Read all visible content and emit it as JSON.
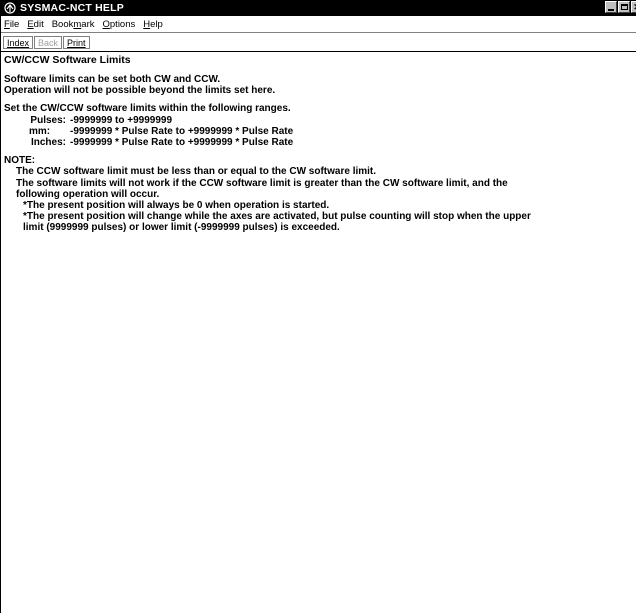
{
  "window": {
    "title": "SYSMAC-NCT HELP"
  },
  "menu": [
    {
      "pre": "",
      "u": "F",
      "post": "ile"
    },
    {
      "pre": "",
      "u": "E",
      "post": "dit"
    },
    {
      "pre": "Book",
      "u": "m",
      "post": "ark"
    },
    {
      "pre": "",
      "u": "O",
      "post": "ptions"
    },
    {
      "pre": "",
      "u": "H",
      "post": "elp"
    }
  ],
  "toolbar": {
    "index_label": "Index",
    "back_label": "Back",
    "print_label": "Print"
  },
  "topic": {
    "title": "CW/CCW Software Limits",
    "intro": [
      "Software limits can be set both CW and CCW.",
      "Operation will not be possible beyond the limits set here."
    ],
    "range_intro": "Set the CW/CCW software limits within the following ranges.",
    "ranges": [
      {
        "label": "Pulses:",
        "value": "-9999999 to +9999999"
      },
      {
        "label": "mm:",
        "value": "-9999999 * Pulse Rate to +9999999 * Pulse Rate"
      },
      {
        "label": "Inches:",
        "value": "-9999999 * Pulse Rate to +9999999 * Pulse Rate"
      }
    ],
    "note_heading": "NOTE:",
    "note_lines": [
      "The CCW software limit must be less than or equal to the CW software limit.",
      "The software limits will not work if the CCW software limit is greater than the CW software limit, and the",
      "following operation will occur."
    ],
    "sub_notes": [
      "*The present position will always be 0 when operation is started.",
      "*The present position will change while the axes are activated, but pulse counting will stop when the upper",
      "limit (9999999 pulses) or lower limit (-9999999 pulses) is exceeded."
    ]
  }
}
